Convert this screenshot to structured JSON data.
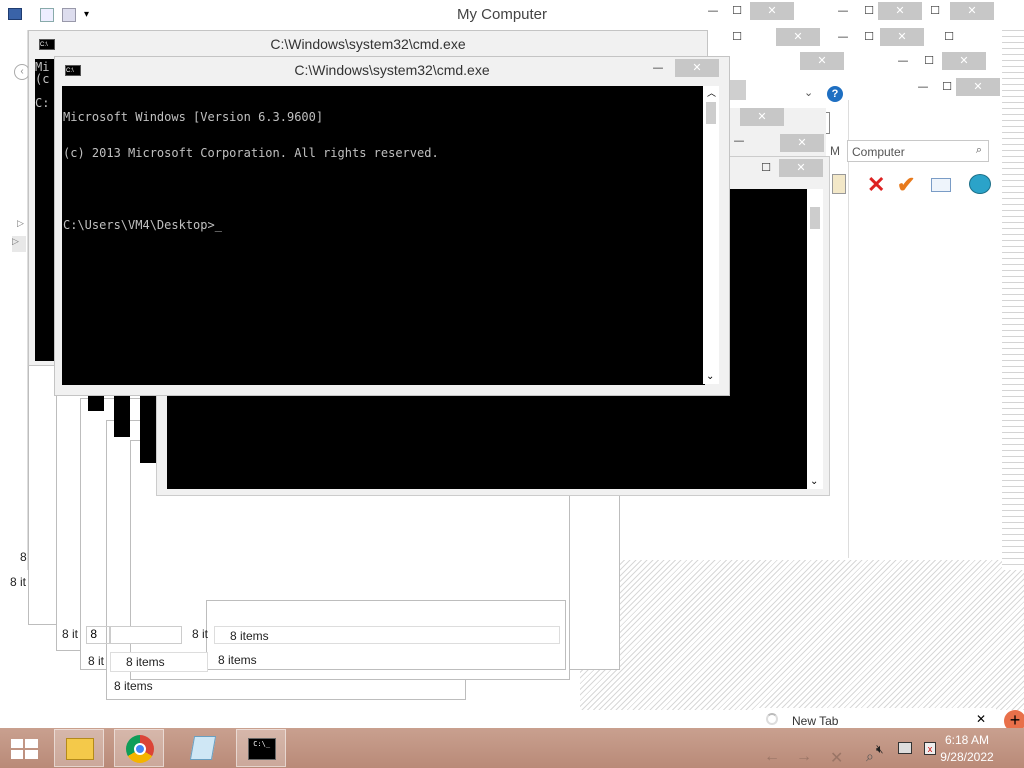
{
  "explorer": {
    "title": "My Computer",
    "search_placeholder": "Computer",
    "search_prefix": "h M",
    "status_items": [
      "8 it",
      "8 it",
      "8 it",
      "8 it",
      "8 items",
      "8 items",
      "8 items"
    ],
    "left_status": "8 it",
    "left_mid": "8"
  },
  "cmd": {
    "title": "C:\\Windows\\system32\\cmd.exe",
    "lines": [
      "Microsoft Windows [Version 6.3.9600]",
      "(c) 2013 Microsoft Corporation. All rights reserved.",
      "",
      "C:\\Users\\VM4\\Desktop>_"
    ],
    "back_fragment_1": "Mi",
    "back_fragment_2": "(c",
    "back_fragment_3": "C:"
  },
  "browser_tab": {
    "label": "New Tab"
  },
  "taskbar": {
    "time": "6:18 AM",
    "date": "9/28/2022",
    "apps": [
      "start",
      "file-explorer",
      "chrome",
      "notepad",
      "cmd"
    ]
  },
  "colors": {
    "taskbar": "#b98a78",
    "close_button": "#c7c7c7",
    "console_bg": "#000000",
    "console_text": "#c0c0c0",
    "accent_blue": "#1e6fc2"
  }
}
